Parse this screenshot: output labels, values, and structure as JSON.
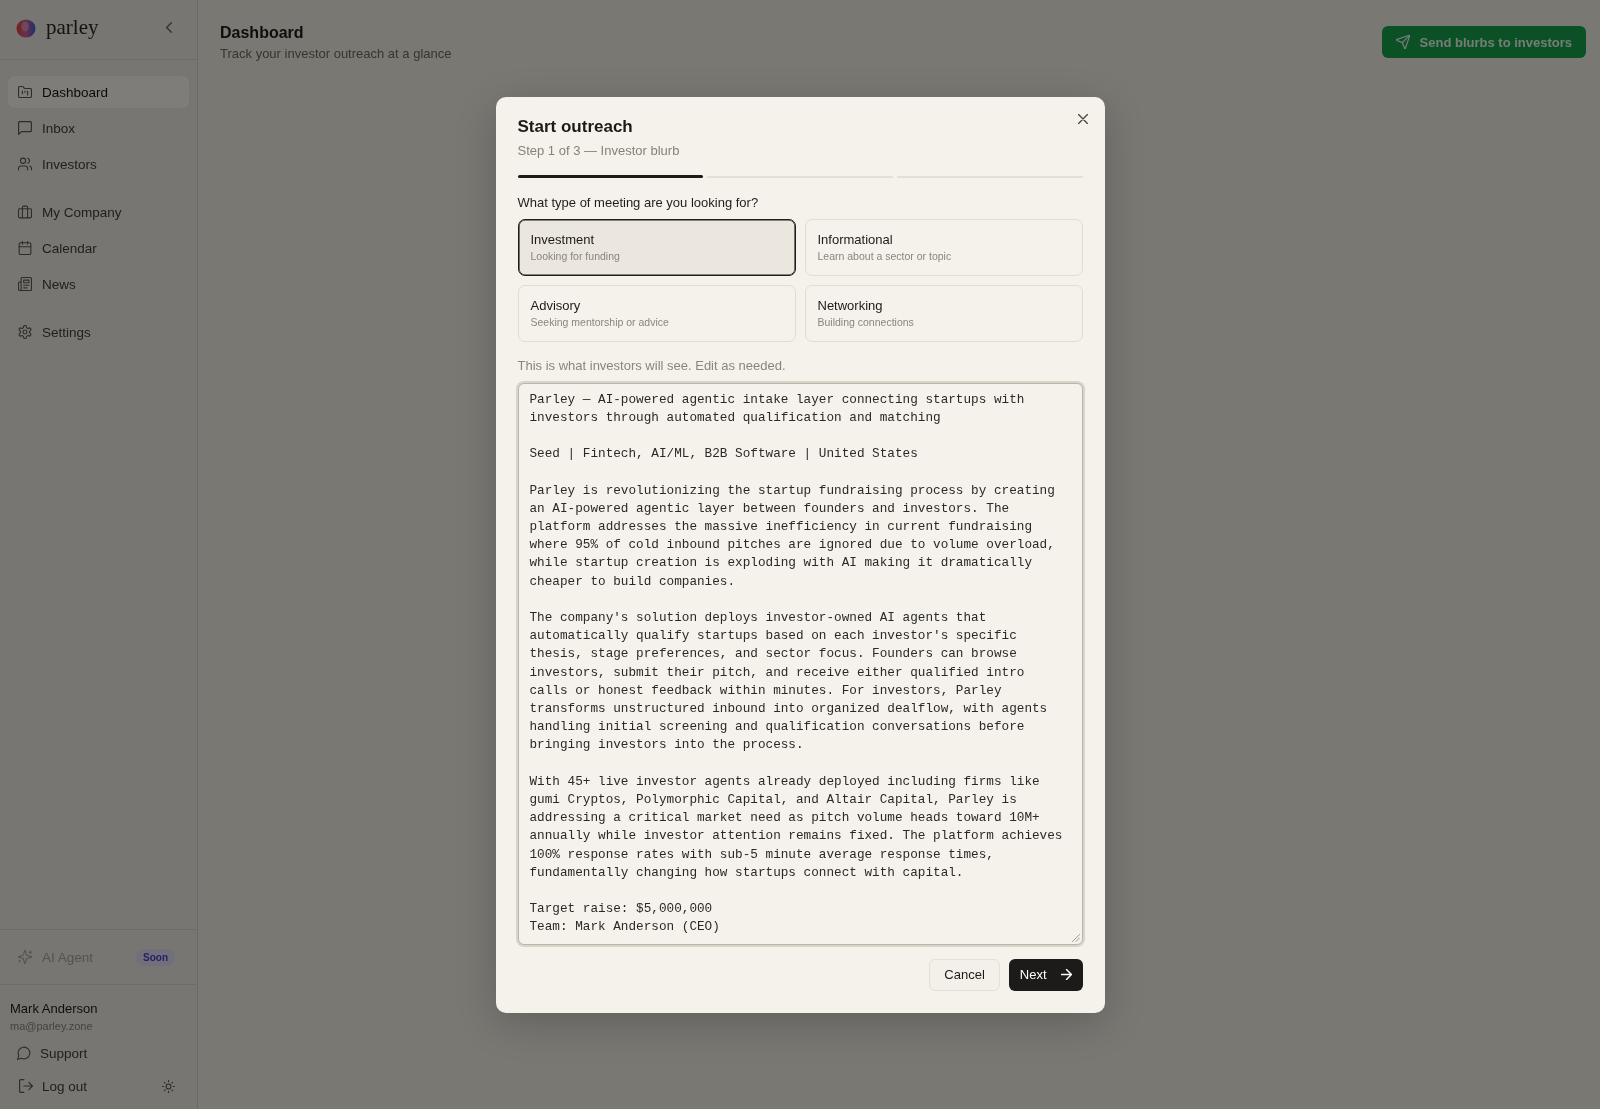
{
  "sidebar": {
    "brand": "parley",
    "nav_groups": [
      {
        "items": [
          {
            "label": "Dashboard",
            "selected": true
          },
          {
            "label": "Inbox",
            "selected": false
          },
          {
            "label": "Investors",
            "selected": false
          }
        ]
      },
      {
        "items": [
          {
            "label": "My Company",
            "selected": false
          },
          {
            "label": "Calendar",
            "selected": false
          },
          {
            "label": "News",
            "selected": false
          }
        ]
      },
      {
        "items": [
          {
            "label": "Settings",
            "selected": false
          }
        ]
      }
    ],
    "ai_agent": {
      "label": "AI Agent",
      "badge": "Soon",
      "disabled": true
    },
    "user": {
      "name": "Mark Anderson",
      "email": "ma@parley.zone"
    },
    "support_link": "Support",
    "logout_button": "Log out"
  },
  "header": {
    "title": "Dashboard",
    "subtitle": "Track your investor outreach at a glance",
    "action_button": "Send blurbs to investors"
  },
  "modal": {
    "title": "Start outreach",
    "step": "Step 1 of 3 — Investor blurb",
    "steps": [
      {
        "completed": true
      },
      {
        "completed": false
      },
      {
        "completed": false
      }
    ],
    "question": "What type of meeting are you looking for?",
    "meeting_types": [
      {
        "title": "Investment",
        "description": "Looking for funding",
        "selected": true
      },
      {
        "title": "Informational",
        "description": "Learn about a sector or topic",
        "selected": false
      },
      {
        "title": "Advisory",
        "description": "Seeking mentorship or advice",
        "selected": false
      },
      {
        "title": "Networking",
        "description": "Building connections",
        "selected": false
      }
    ],
    "blurb_hint": "This is what investors will see. Edit as needed.",
    "blurb": {
      "value": "Parley — AI-powered agentic intake layer connecting startups with investors through automated qualification and matching\n\nSeed | Fintech, AI/ML, B2B Software | United States\n\nParley is revolutionizing the startup fundraising process by creating an AI-powered agentic layer between founders and investors. The platform addresses the massive inefficiency in current fundraising where 95% of cold inbound pitches are ignored due to volume overload, while startup creation is exploding with AI making it dramatically cheaper to build companies.\n\nThe company's solution deploys investor-owned AI agents that automatically qualify startups based on each investor's specific thesis, stage preferences, and sector focus. Founders can browse investors, submit their pitch, and receive either qualified intro calls or honest feedback within minutes. For investors, Parley transforms unstructured inbound into organized dealflow, with agents handling initial screening and qualification conversations before bringing investors into the process.\n\nWith 45+ live investor agents already deployed including firms like gumi Cryptos, Polymorphic Capital, and Altair Capital, Parley is addressing a critical market need as pitch volume heads toward 10M+ annually while investor attention remains fixed. The platform achieves 100% response rates with sub-5 minute average response times, fundamentally changing how startups connect with capital.\n\nTarget raise: $5,000,000\nTeam: Mark Anderson (CEO)",
      "focused": true
    },
    "buttons": [
      {
        "label": "Cancel",
        "kind": "secondary"
      },
      {
        "label": "Next",
        "kind": "primary"
      }
    ]
  }
}
